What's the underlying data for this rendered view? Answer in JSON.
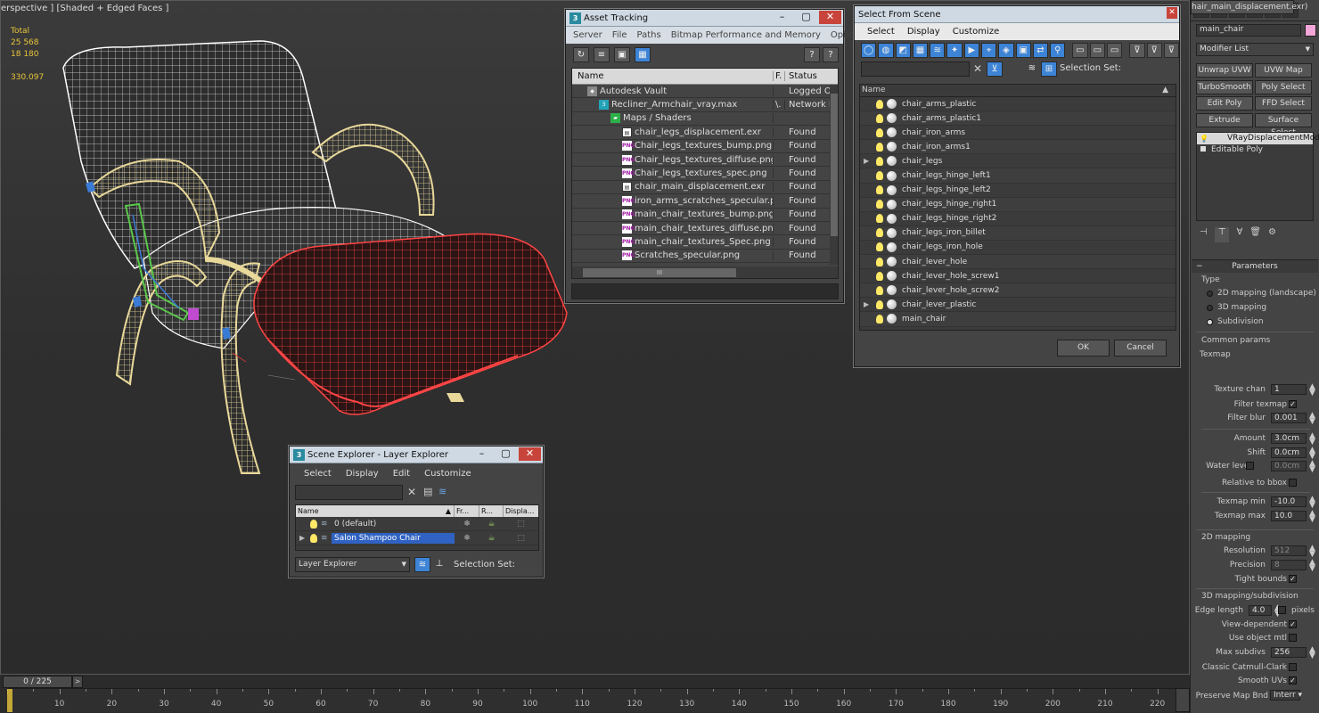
{
  "viewport": {
    "label": "erspective ] [Shaded + Edged Faces ]",
    "stats": {
      "total_label": "Total",
      "polys": "25 568",
      "verts": "18 180",
      "fps": "330.097"
    },
    "colors": {
      "wire_white": "#ffffff",
      "wire_yellow": "#e8d89a",
      "wire_red": "#ff4040",
      "wire_green": "#59c84a",
      "wire_blue": "#3a7bd5"
    }
  },
  "timeline": {
    "frame_display": "0 / 225",
    "next_label": ">",
    "ticks": [
      "10",
      "20",
      "30",
      "40",
      "50",
      "60",
      "70",
      "80",
      "90",
      "100",
      "110",
      "120",
      "130",
      "140",
      "150",
      "160",
      "170",
      "180",
      "190",
      "200",
      "210",
      "220"
    ]
  },
  "asset_tracking": {
    "title": "Asset Tracking",
    "menu": [
      "Server",
      "File",
      "Paths",
      "Bitmap Performance and Memory",
      "Options"
    ],
    "toolbar_icons": [
      "refresh-icon",
      "list-icon",
      "thumbnail-icon",
      "table-icon"
    ],
    "columns": {
      "name": "Name",
      "f": "F.",
      "status": "Status"
    },
    "rows": [
      {
        "name": "Autodesk Vault",
        "f": "",
        "status": "Logged O",
        "icon": "vault-icon",
        "indent": 1
      },
      {
        "name": "Recliner_Armchair_vray.max",
        "f": "\\.",
        "status": "Network P",
        "icon": "max-file-icon",
        "indent": 2
      },
      {
        "name": "Maps / Shaders",
        "f": "",
        "status": "",
        "icon": "maps-icon",
        "indent": 3
      },
      {
        "name": "chair_legs_displacement.exr",
        "f": "",
        "status": "Found",
        "icon": "exr-file-icon",
        "indent": 4
      },
      {
        "name": "Chair_legs_textures_bump.png",
        "f": "",
        "status": "Found",
        "icon": "png-file-icon",
        "indent": 4
      },
      {
        "name": "Chair_legs_textures_diffuse.png",
        "f": "",
        "status": "Found",
        "icon": "png-file-icon",
        "indent": 4
      },
      {
        "name": "Chair_legs_textures_spec.png",
        "f": "",
        "status": "Found",
        "icon": "png-file-icon",
        "indent": 4
      },
      {
        "name": "chair_main_displacement.exr",
        "f": "",
        "status": "Found",
        "icon": "exr-file-icon",
        "indent": 4
      },
      {
        "name": "iron_arms_scratches_specular.png",
        "f": "",
        "status": "Found",
        "icon": "png-file-icon",
        "indent": 4
      },
      {
        "name": "main_chair_textures_bump.png",
        "f": "",
        "status": "Found",
        "icon": "png-file-icon",
        "indent": 4
      },
      {
        "name": "main_chair_textures_diffuse.png",
        "f": "",
        "status": "Found",
        "icon": "png-file-icon",
        "indent": 4
      },
      {
        "name": "main_chair_textures_Spec.png",
        "f": "",
        "status": "Found",
        "icon": "png-file-icon",
        "indent": 4
      },
      {
        "name": "Scratches_specular.png",
        "f": "",
        "status": "Found",
        "icon": "png-file-icon",
        "indent": 4
      }
    ],
    "scroll_thumb_label": "III"
  },
  "select_from_scene": {
    "title": "Select From Scene",
    "menu": [
      "Select",
      "Display",
      "Customize"
    ],
    "selection_set_label": "Selection Set:",
    "column_name": "Name",
    "items": [
      {
        "name": "chair_arms_plastic",
        "expand": false
      },
      {
        "name": "chair_arms_plastic1",
        "expand": false
      },
      {
        "name": "chair_iron_arms",
        "expand": false
      },
      {
        "name": "chair_iron_arms1",
        "expand": false
      },
      {
        "name": "chair_legs",
        "expand": true
      },
      {
        "name": "chair_legs_hinge_left1",
        "expand": false
      },
      {
        "name": "chair_legs_hinge_left2",
        "expand": false
      },
      {
        "name": "chair_legs_hinge_right1",
        "expand": false
      },
      {
        "name": "chair_legs_hinge_right2",
        "expand": false
      },
      {
        "name": "chair_legs_iron_billet",
        "expand": false
      },
      {
        "name": "chair_legs_iron_hole",
        "expand": false
      },
      {
        "name": "chair_lever_hole",
        "expand": false
      },
      {
        "name": "chair_lever_hole_screw1",
        "expand": false
      },
      {
        "name": "chair_lever_hole_screw2",
        "expand": false
      },
      {
        "name": "chair_lever_plastic",
        "expand": true
      },
      {
        "name": "main_chair",
        "expand": false
      }
    ],
    "ok_label": "OK",
    "cancel_label": "Cancel"
  },
  "scene_explorer": {
    "title": "Scene Explorer - Layer Explorer",
    "menu": [
      "Select",
      "Display",
      "Edit",
      "Customize"
    ],
    "columns": {
      "name": "Name",
      "freeze": "Fr...",
      "render": "R...",
      "display": "Displa..."
    },
    "layers": [
      {
        "name": "0 (default)",
        "selected": false
      },
      {
        "name": "Salon Shampoo Chair",
        "selected": true
      }
    ],
    "explorer_dropdown": "Layer Explorer",
    "selection_set_label": "Selection Set:"
  },
  "command_panel": {
    "object_name": "main_chair",
    "object_color": "#f3a6d8",
    "modifier_list_label": "Modifier List",
    "modifier_buttons": [
      [
        "Unwrap UVW",
        "UVW Map"
      ],
      [
        "TurboSmooth",
        "Poly Select"
      ],
      [
        "Edit Poly",
        "FFD Select"
      ],
      [
        "Extrude",
        "Surface Select"
      ]
    ],
    "stack": [
      "VRayDisplacementMod",
      "Editable Poly"
    ],
    "parameters": {
      "rollout_title": "Parameters",
      "type_label": "Type",
      "type_options": [
        "2D mapping (landscape)",
        "3D mapping",
        "Subdivision"
      ],
      "selected_type": "Subdivision",
      "common_params_label": "Common params",
      "texmap_label": "Texmap",
      "texmap_value": "hair_main_displacement.exr)",
      "texture_chan_label": "Texture chan",
      "texture_chan_value": "1",
      "filter_texmap_label": "Filter texmap",
      "filter_blur_label": "Filter blur",
      "filter_blur_value": "0.001",
      "amount_label": "Amount",
      "amount_value": "3.0cm",
      "shift_label": "Shift",
      "shift_value": "0.0cm",
      "water_level_label": "Water level",
      "water_level_value": "0.0cm",
      "relative_bbox_label": "Relative to bbox",
      "texmap_min_label": "Texmap min",
      "texmap_min_value": "-10.0",
      "texmap_max_label": "Texmap max",
      "texmap_max_value": "10.0",
      "mapping2d_label": "2D mapping",
      "resolution_label": "Resolution",
      "resolution_value": "512",
      "precision_label": "Precision",
      "precision_value": "8",
      "tight_bounds_label": "Tight bounds",
      "mapping3d_label": "3D mapping/subdivision",
      "edge_length_label": "Edge length",
      "edge_length_value": "4.0",
      "pixels_label": "pixels",
      "view_dependent_label": "View-dependent",
      "use_object_mtl_label": "Use object mtl",
      "max_subdivs_label": "Max subdivs",
      "max_subdivs_value": "256",
      "classic_cc_label": "Classic Catmull-Clark",
      "smooth_uvs_label": "Smooth UVs",
      "preserve_map_label": "Preserve Map Bnd",
      "preserve_map_value": "Interr"
    }
  }
}
